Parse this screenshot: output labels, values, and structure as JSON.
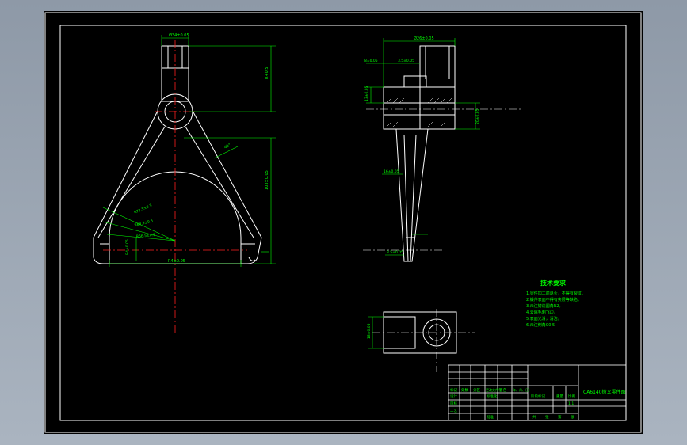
{
  "colors": {
    "viewport_bg": "#9aa5b2",
    "paper": "#000000",
    "frame": "#ffffff",
    "dimension": "#00ff00",
    "centerline": "#ff2020",
    "hatch": "#ffffff"
  },
  "dimensions": {
    "top_width": "Ø34±0.05",
    "overall_height": "R+0.5",
    "fork_height": "103±0.05",
    "arm_angle": "45°",
    "radius_1": "R72.5±0.5",
    "radius_2": "R68.5±0.5",
    "radius_3": "R66.5±0.5",
    "fork_span": "R4±0.05",
    "bottom_width": "R4±0.05",
    "side_top_width": "Ø26±0.05",
    "side_boss_height": "8±0.05",
    "side_left_height": "13±0.05",
    "side_right_height": "20±0.05",
    "side_small": "3.5±0.05",
    "side_stem_width": "16±0.05",
    "bottom_view_height": "18±0.05"
  },
  "notes": {
    "title": "技术要求",
    "lines": [
      "1.零件加工前退火，不得有裂纹。",
      "2.锻件表面不得有夹层等缺陷。",
      "3.未注铸造圆角R2。",
      "4.去除毛刺飞边。",
      "5.表面光滑，清洁。",
      "6.未注倒角C0.5"
    ]
  },
  "title_block": {
    "drawing_name": "CA6140拨叉零件图",
    "scale": "1:1",
    "left_labels": [
      "标记",
      "处数",
      "分区",
      "更改文件号",
      "签名",
      "年、月、日"
    ],
    "row_labels": [
      "设计",
      "审核",
      "工艺",
      "批准"
    ],
    "standardization": "标准化",
    "mid_labels": [
      "阶段标记",
      "重量",
      "比例"
    ],
    "sheet_labels": [
      "共",
      "张",
      "第",
      "张"
    ]
  }
}
